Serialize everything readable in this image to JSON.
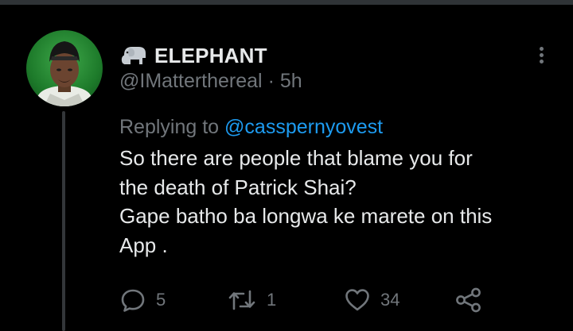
{
  "tweet": {
    "author_name": "ELEPHANT",
    "author_emoji": "elephant-emoji",
    "handle": "@IMatterthereal",
    "separator": "·",
    "time": "5h",
    "reply_prefix": "Replying to",
    "reply_to": "@casspernyovest",
    "text_lines": [
      "So there are people that blame you for",
      "the death of Patrick Shai?",
      "Gape batho ba longwa ke marete on this",
      "App ."
    ]
  },
  "actions": {
    "reply_count": "5",
    "retweet_count": "1",
    "like_count": "34"
  },
  "colors": {
    "background": "#000000",
    "text": "#e7e9ea",
    "secondary": "#71767b",
    "link": "#1d9bf0",
    "divider": "#2f3336"
  },
  "icons": [
    "more-options-icon",
    "reply-icon",
    "retweet-icon",
    "like-icon",
    "share-icon"
  ]
}
